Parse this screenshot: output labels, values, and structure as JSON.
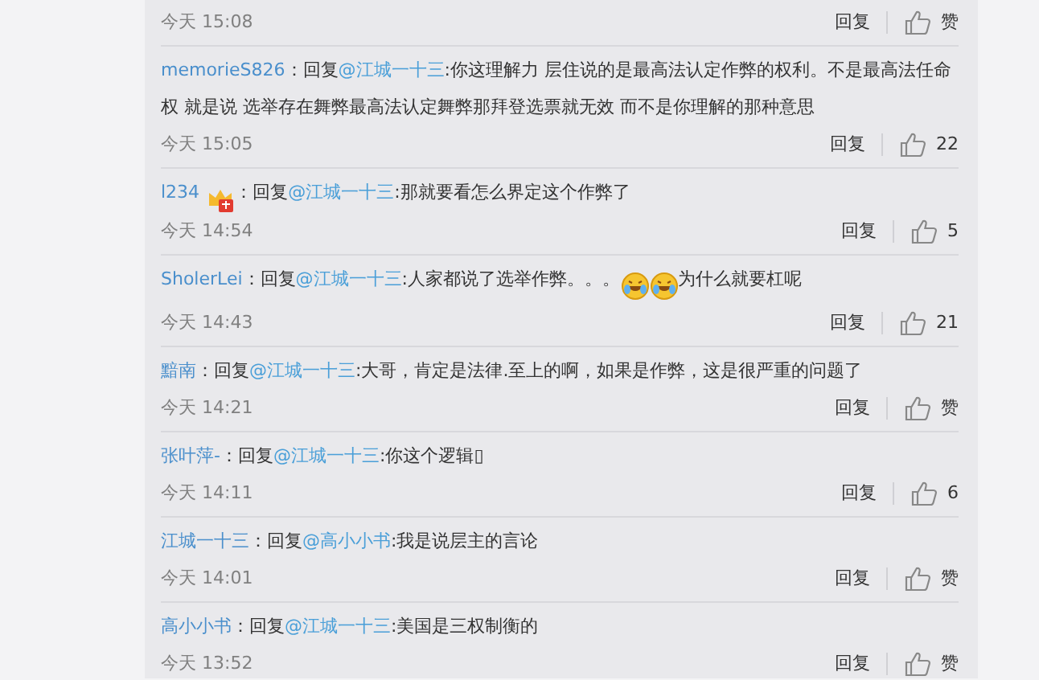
{
  "comments": [
    {
      "time": "今天 15:08",
      "reply": "回复",
      "likes": "赞"
    },
    {
      "user": "memorieS826",
      "prefix": "：回复",
      "reply_to": "@江城一十三",
      "content": [
        {
          "kind": "text",
          "text": ":你这理解力 层住说的是最高法认定作弊的权利。不是最高法任命权 就是说 选举存在舞弊最高法认定舞弊那拜登选票就无效 而不是你理解的那种意思"
        }
      ],
      "time": "今天 15:05",
      "reply": "回复",
      "likes": "22"
    },
    {
      "user": "l234",
      "prefix": "：回复",
      "badge": true,
      "reply_to": "@江城一十三",
      "content": [
        {
          "kind": "text",
          "text": ":那就要看怎么界定这个作弊了"
        }
      ],
      "time": "今天 14:54",
      "reply": "回复",
      "likes": "5"
    },
    {
      "user": "SholerLei",
      "prefix": "：回复",
      "reply_to": "@江城一十三",
      "content": [
        {
          "kind": "text",
          "text": ":人家都说了选举作弊。。。"
        },
        {
          "kind": "emoji"
        },
        {
          "kind": "emoji"
        },
        {
          "kind": "text",
          "text": "为什么就要杠呢"
        }
      ],
      "time": "今天 14:43",
      "reply": "回复",
      "likes": "21"
    },
    {
      "user": "黯南",
      "prefix": "：回复",
      "reply_to": "@江城一十三",
      "content": [
        {
          "kind": "text",
          "text": ":大哥，肯定是法律.至上的啊，如果是作弊，这是很严重的问题了"
        }
      ],
      "time": "今天 14:21",
      "reply": "回复",
      "likes": "赞"
    },
    {
      "user": "张叶萍-",
      "prefix": "：回复",
      "reply_to": "@江城一十三",
      "content": [
        {
          "kind": "text",
          "text": ":你这个逻辑▯"
        }
      ],
      "time": "今天 14:11",
      "reply": "回复",
      "likes": "6"
    },
    {
      "user": "江城一十三",
      "prefix": "：回复",
      "reply_to": "@高小小书",
      "content": [
        {
          "kind": "text",
          "text": ":我是说层主的言论"
        }
      ],
      "time": "今天 14:01",
      "reply": "回复",
      "likes": "赞"
    },
    {
      "user": "高小小书",
      "prefix": "：回复",
      "reply_to": "@江城一十三",
      "content": [
        {
          "kind": "text",
          "text": ":美国是三权制衡的"
        }
      ],
      "time": "今天 13:52",
      "reply": "回复",
      "likes": "赞"
    }
  ]
}
